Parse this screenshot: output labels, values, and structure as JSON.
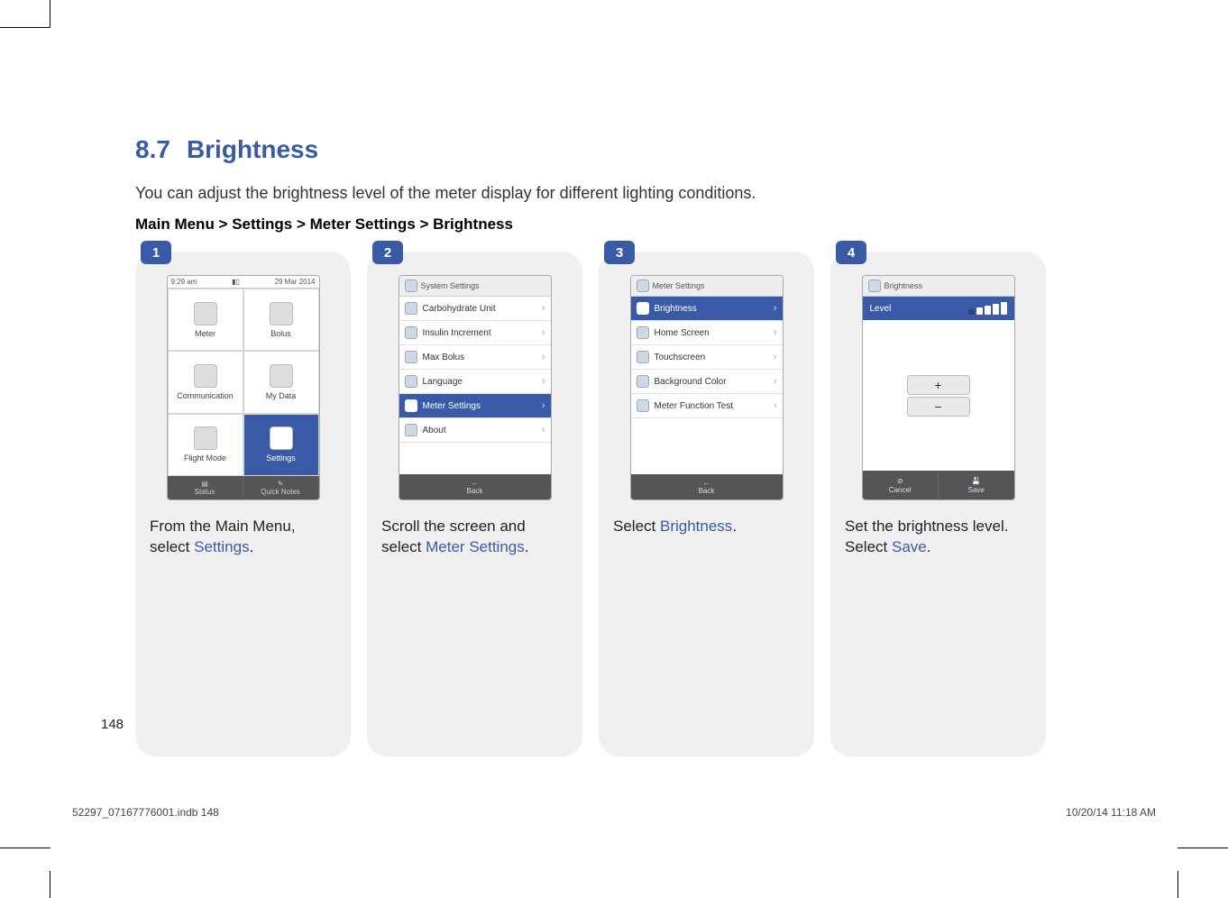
{
  "heading_number": "8.7",
  "heading_title": "Brightness",
  "intro_text": "You can adjust the brightness level of the meter display for different lighting conditions.",
  "breadcrumb": "Main Menu > Settings > Meter Settings > Brightness",
  "page_number": "148",
  "footer_left": "52297_07167776001.indb   148",
  "footer_right": "10/20/14   11:18 AM",
  "steps": [
    {
      "num": "1",
      "caption_pre": "From the Main Menu, select ",
      "caption_hl": "Settings",
      "caption_post": ".",
      "screen": {
        "time": "9:29 am",
        "date": "29 Mar 2014",
        "grid": [
          "Meter",
          "Bolus",
          "Communication",
          "My Data",
          "Flight Mode",
          "Settings"
        ],
        "selected_index": 5,
        "foot": [
          "Status",
          "Quick Notes"
        ]
      }
    },
    {
      "num": "2",
      "caption_pre": "Scroll the screen and select ",
      "caption_hl": "Meter Settings",
      "caption_post": ".",
      "screen": {
        "header": "System Settings",
        "rows": [
          "Carbohydrate Unit",
          "Insulin Increment",
          "Max Bolus",
          "Language",
          "Meter Settings",
          "About"
        ],
        "selected_index": 4,
        "foot_label": "Back"
      }
    },
    {
      "num": "3",
      "caption_pre": "Select ",
      "caption_hl": "Brightness",
      "caption_post": ".",
      "screen": {
        "header": "Meter Settings",
        "rows": [
          "Brightness",
          "Home Screen",
          "Touchscreen",
          "Background Color",
          "Meter Function Test"
        ],
        "selected_index": 0,
        "foot_label": "Back"
      }
    },
    {
      "num": "4",
      "caption_pre": "Set the brightness level. Select ",
      "caption_hl": "Save",
      "caption_post": ".",
      "screen": {
        "header": "Brightness",
        "level_label": "Level",
        "bars_total": 5,
        "bars_lit": 4,
        "foot": [
          "Cancel",
          "Save"
        ]
      }
    }
  ]
}
